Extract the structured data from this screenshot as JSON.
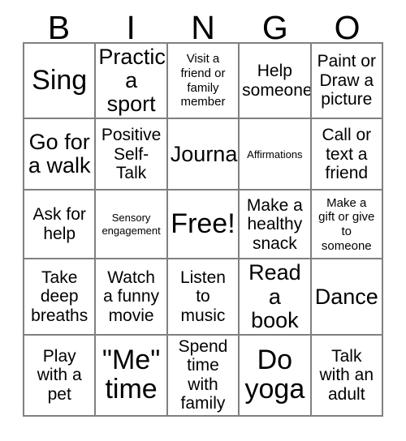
{
  "header": {
    "letters": [
      "B",
      "I",
      "N",
      "G",
      "O"
    ]
  },
  "grid": {
    "rows": [
      [
        {
          "text": "Sing",
          "size": "t-xxl"
        },
        {
          "text": "Practice\na sport",
          "size": "t-xl"
        },
        {
          "text": "Visit a\nfriend or\nfamily\nmember",
          "size": "t-sm"
        },
        {
          "text": "Help\nsomeone",
          "size": "t-md"
        },
        {
          "text": "Paint or\nDraw a\npicture",
          "size": "t-md"
        }
      ],
      [
        {
          "text": "Go for\na walk",
          "size": "t-xl"
        },
        {
          "text": "Positive\nSelf-\nTalk",
          "size": "t-md"
        },
        {
          "text": "Journal",
          "size": "t-xl"
        },
        {
          "text": "Affirmations",
          "size": "t-xs"
        },
        {
          "text": "Call or\ntext a\nfriend",
          "size": "t-md"
        }
      ],
      [
        {
          "text": "Ask for\nhelp",
          "size": "t-md"
        },
        {
          "text": "Sensory\nengagement",
          "size": "t-xs"
        },
        {
          "text": "Free!",
          "size": "t-xxl"
        },
        {
          "text": "Make a\nhealthy\nsnack",
          "size": "t-md"
        },
        {
          "text": "Make a\ngift or give\nto\nsomeone",
          "size": "t-sm"
        }
      ],
      [
        {
          "text": "Take\ndeep\nbreaths",
          "size": "t-md"
        },
        {
          "text": "Watch\na funny\nmovie",
          "size": "t-md"
        },
        {
          "text": "Listen\nto\nmusic",
          "size": "t-md"
        },
        {
          "text": "Read\na book",
          "size": "t-xl"
        },
        {
          "text": "Dance",
          "size": "t-xl"
        }
      ],
      [
        {
          "text": "Play\nwith a\npet",
          "size": "t-md"
        },
        {
          "text": "\"Me\"\ntime",
          "size": "t-xxl"
        },
        {
          "text": "Spend\ntime with\nfamily",
          "size": "t-md"
        },
        {
          "text": "Do\nyoga",
          "size": "t-xxl"
        },
        {
          "text": "Talk\nwith an\nadult",
          "size": "t-md"
        }
      ]
    ]
  },
  "colors": {
    "border": "#808080",
    "text": "#000000",
    "background": "#ffffff"
  }
}
